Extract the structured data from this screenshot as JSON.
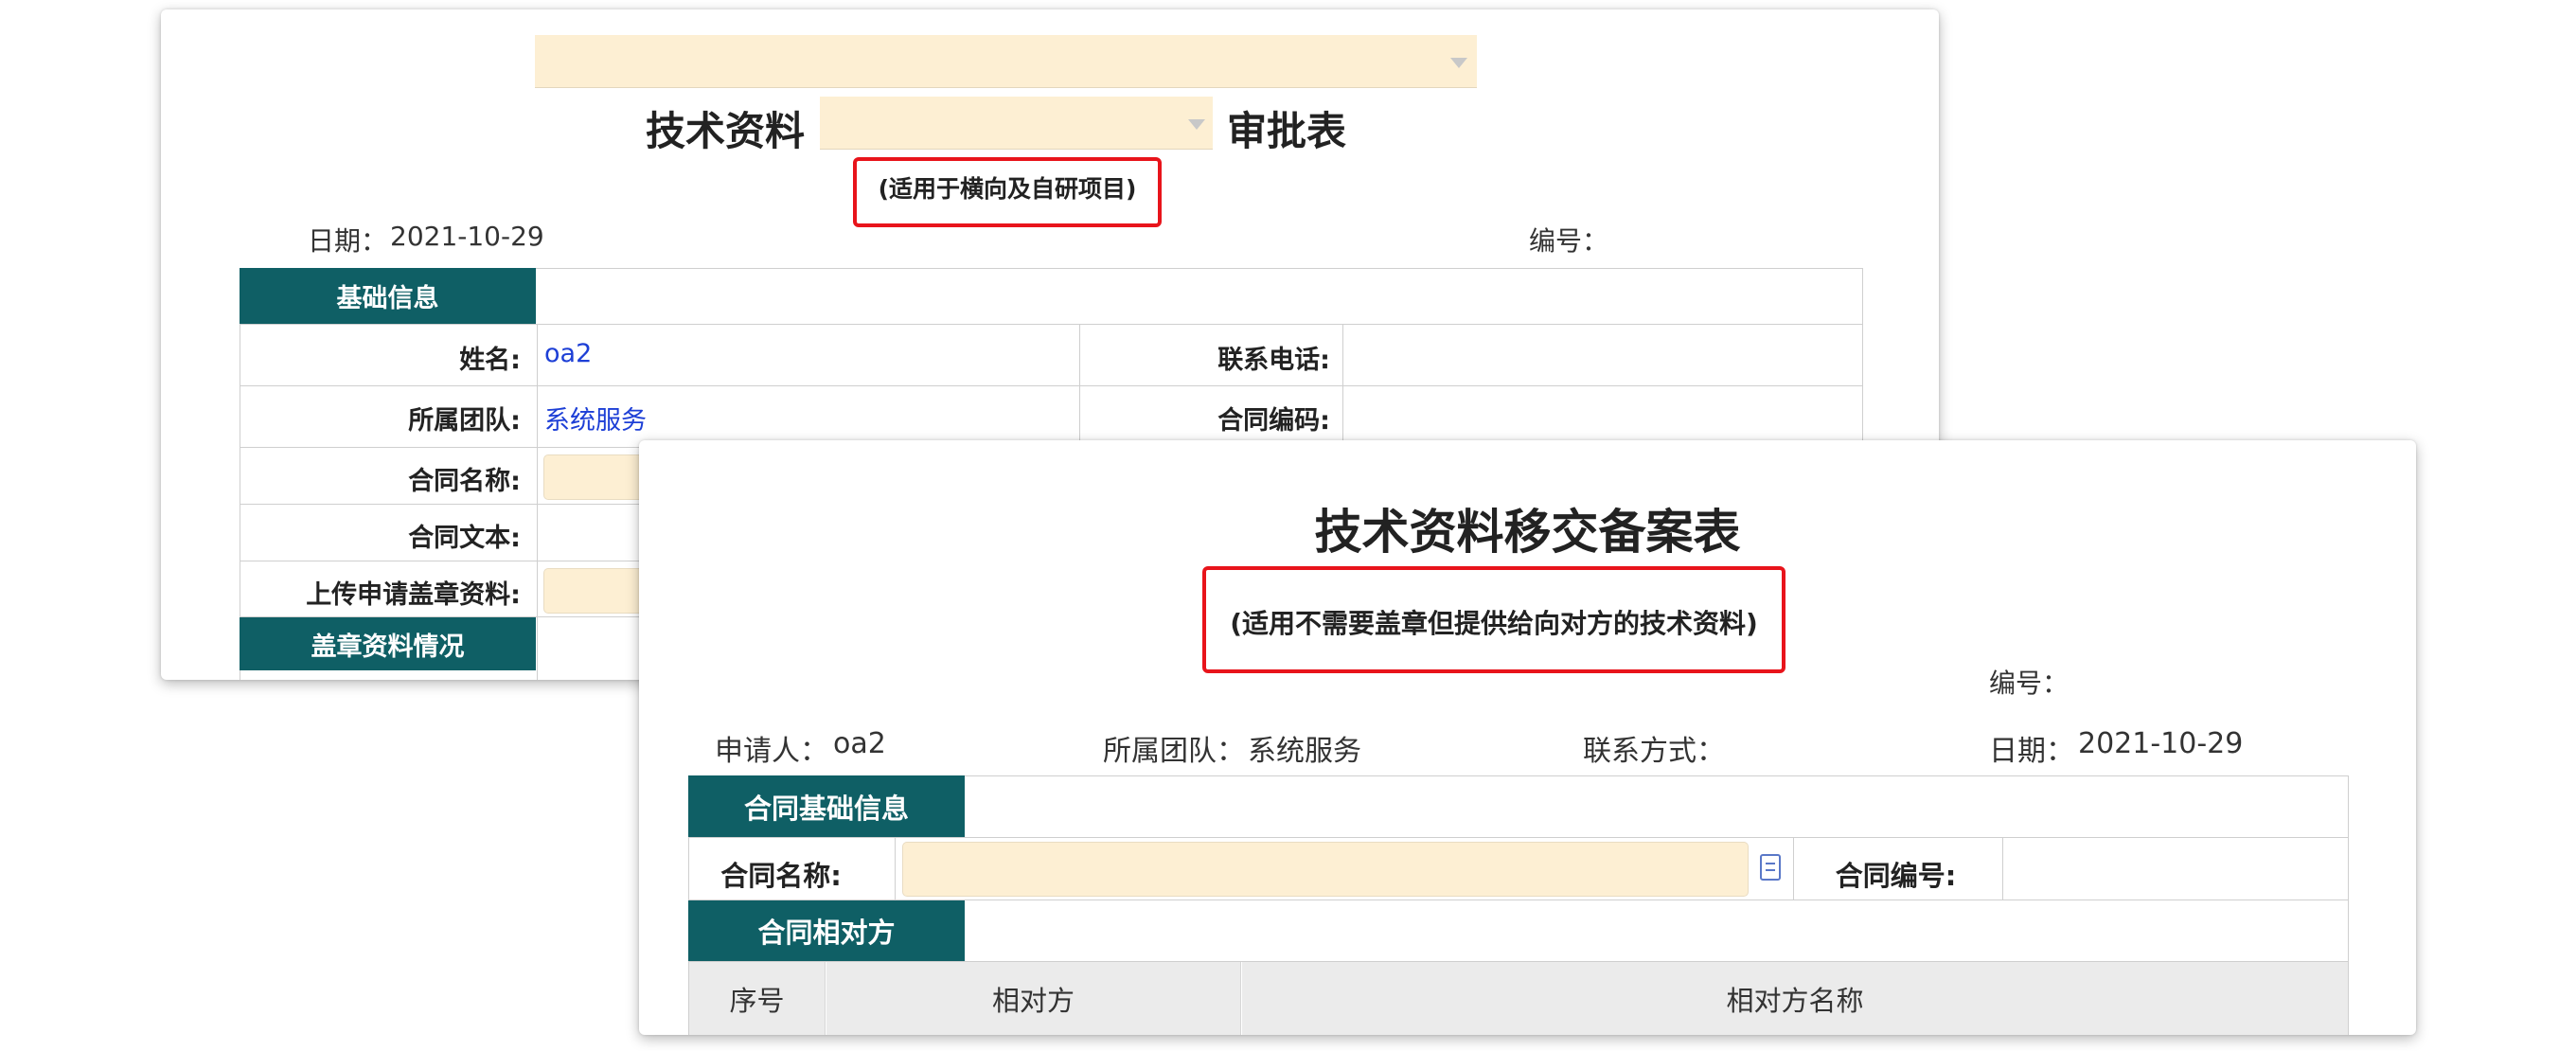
{
  "card_a": {
    "title_left": "技术资料",
    "title_right": "审批表",
    "note": "(适用于横向及自研项目)",
    "date_label": "日期：",
    "date_value": "2021-10-29",
    "number_label": "编号：",
    "section_basic": "基础信息",
    "name_label": "姓名:",
    "name_value": "oa2",
    "phone_label": "联系电话:",
    "team_label": "所属团队:",
    "team_value": "系统服务",
    "contract_code_label": "合同编码:",
    "contract_name_label": "合同名称:",
    "contract_text_label": "合同文本:",
    "upload_label": "上传申请盖章资料:",
    "section_seal": "盖章资料情况"
  },
  "card_b": {
    "title": "技术资料移交备案表",
    "note": "(适用不需要盖章但提供给向对方的技术资料)",
    "number_label": "编号：",
    "applicant_label": "申请人：",
    "applicant_value": "oa2",
    "team_label": "所属团队：",
    "team_value": "系统服务",
    "contact_label": "联系方式：",
    "date_label": "日期：",
    "date_value": "2021-10-29",
    "section_contract_basic": "合同基础信息",
    "contract_name_label": "合同名称:",
    "contract_number_label": "合同编号:",
    "section_counterparty": "合同相对方",
    "col_index": "序号",
    "col_counterparty": "相对方",
    "col_counterparty_name": "相对方名称"
  },
  "icons": {
    "select_caret": "chevron-down-icon",
    "lookup": "lookup-list-icon"
  },
  "colors": {
    "section_header_bg": "#0f5f65",
    "input_bg": "#fdefd3",
    "highlight_border": "#e8141b",
    "link_text": "#1d3fd6"
  }
}
